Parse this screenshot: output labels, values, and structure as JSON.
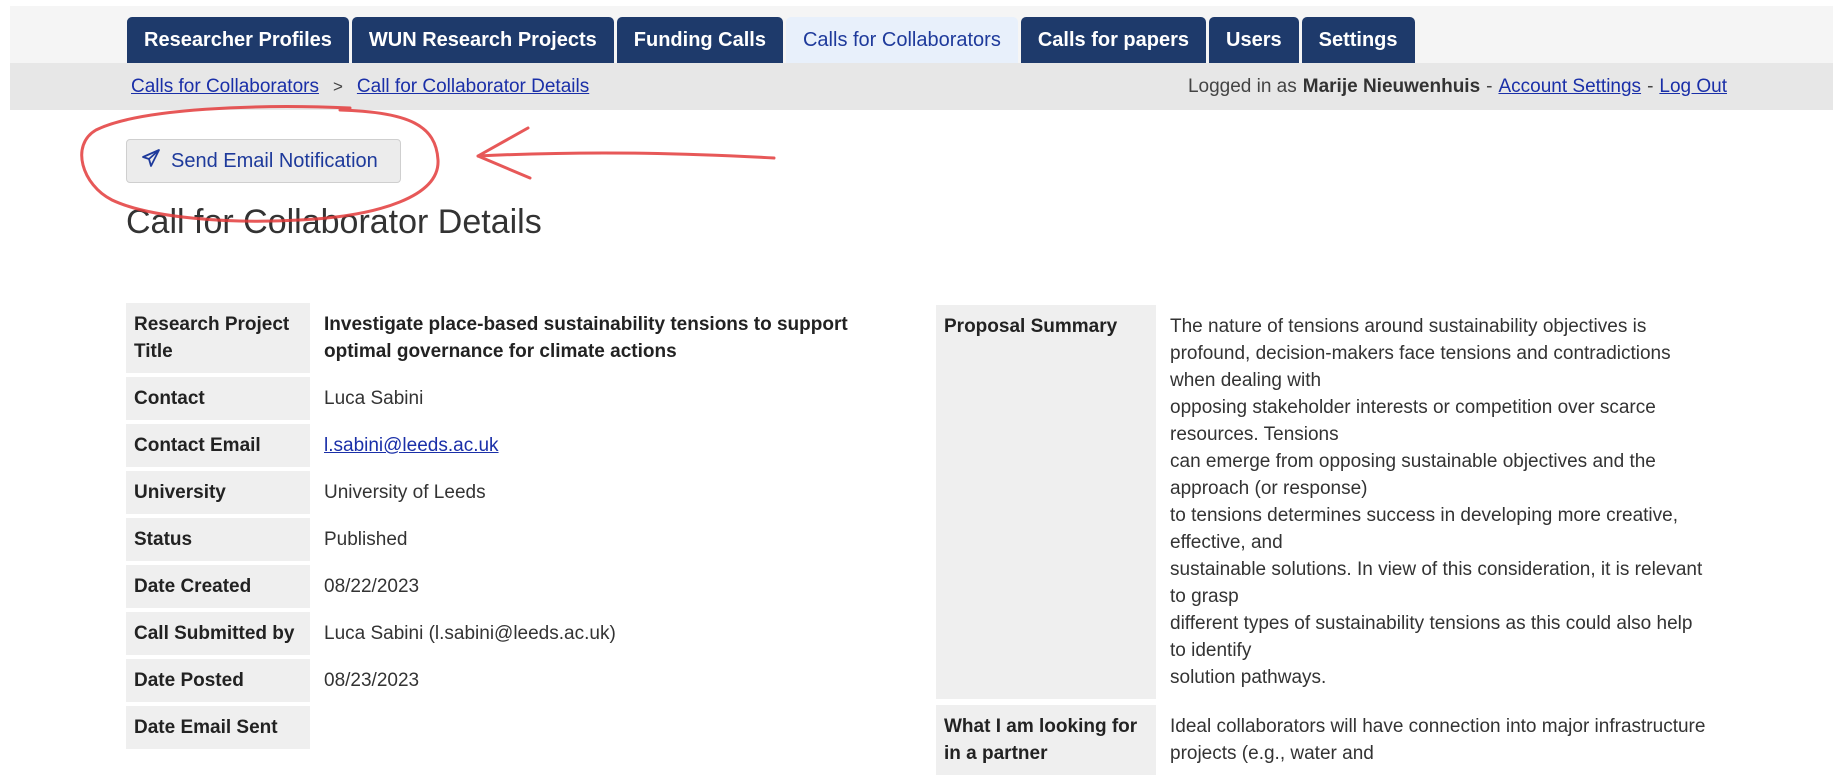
{
  "nav": {
    "tabs": [
      {
        "label": "Researcher Profiles"
      },
      {
        "label": "WUN Research Projects"
      },
      {
        "label": "Funding Calls"
      },
      {
        "label": "Calls for Collaborators"
      },
      {
        "label": "Calls for papers"
      },
      {
        "label": "Users"
      },
      {
        "label": "Settings"
      }
    ],
    "active_tab": "Calls for Collaborators"
  },
  "breadcrumb": {
    "items": [
      "Calls for Collaborators",
      "Call for Collaborator Details"
    ],
    "separator": ">"
  },
  "user_bar": {
    "prefix": "Logged in as",
    "user_name": "Marije Nieuwenhuis",
    "dash": "-",
    "account_settings": "Account Settings",
    "log_out": "Log Out"
  },
  "actions": {
    "send_email_label": "Send Email Notification",
    "send_icon": "paper-plane-icon"
  },
  "page_title": "Call for Collaborator Details",
  "details": {
    "rows": [
      {
        "label": "Research Project Title",
        "value": "Investigate place-based sustainability tensions to support optimal governance for climate actions"
      },
      {
        "label": "Contact",
        "value": "Luca Sabini"
      },
      {
        "label": "Contact Email",
        "value": "l.sabini@leeds.ac.uk"
      },
      {
        "label": "University",
        "value": "University of Leeds"
      },
      {
        "label": "Status",
        "value": "Published"
      },
      {
        "label": "Date Created",
        "value": "08/22/2023"
      },
      {
        "label": "Call Submitted by",
        "value": "Luca Sabini (l.sabini@leeds.ac.uk)"
      },
      {
        "label": "Date Posted",
        "value": "08/23/2023"
      },
      {
        "label": "Date Email Sent",
        "value": ""
      }
    ]
  },
  "side_details": {
    "proposal_summary_label": "Proposal Summary",
    "proposal_summary_lines": [
      "The nature of tensions around sustainability objectives is profound, decision-makers face tensions and contradictions when dealing with",
      "opposing stakeholder interests or competition over scarce resources. Tensions",
      "can emerge from opposing sustainable objectives and the approach (or response)",
      "to tensions determines success in developing more creative, effective, and",
      "sustainable solutions. In view of this consideration, it is relevant to grasp",
      "different types of sustainability tensions as this could also help to identify",
      "solution pathways."
    ],
    "looking_for_label": "What I am looking for in a partner",
    "looking_for_value": "Ideal collaborators will have connection into major infrastructure projects (e.g., water and"
  },
  "colors": {
    "tab_bg": "#1e3a6b",
    "tab_active_bg": "#e8f0fb",
    "link": "#1a2fa8",
    "annotation": "#e33b3b"
  }
}
